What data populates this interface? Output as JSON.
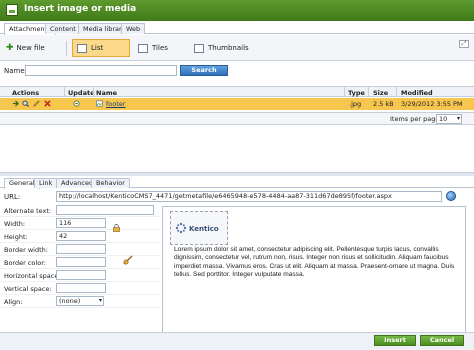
{
  "window": {
    "title": "Insert image or media"
  },
  "top_tabs": [
    "Attachments",
    "Content",
    "Media libraries",
    "Web"
  ],
  "toolbar": {
    "new_file": "New file",
    "list": "List",
    "tiles": "Tiles",
    "thumbnails": "Thumbnails"
  },
  "search": {
    "name_label": "Name:",
    "name_value": "",
    "button": "Search"
  },
  "grid": {
    "headers": {
      "actions": "Actions",
      "update": "Update",
      "name": "Name",
      "type": "Type",
      "size": "Size",
      "modified": "Modified"
    },
    "rows": [
      {
        "name": "footer",
        "type": ".jpg",
        "size": "2.5 kB",
        "modified": "3/29/2012 3:55 PM"
      }
    ]
  },
  "pager": {
    "label": "Items per page:",
    "value": "10"
  },
  "props_tabs": [
    "General",
    "Link",
    "Advanced",
    "Behavior"
  ],
  "url": {
    "label": "URL:",
    "value": "http://localhost/KenticoCMS7_4471/getmetafile/e6465948-e578-4484-aa87-311d67de895f/footer.aspx"
  },
  "props": {
    "alternate_text": {
      "label": "Alternate text:",
      "value": ""
    },
    "width": {
      "label": "Width:",
      "value": "116"
    },
    "height": {
      "label": "Height:",
      "value": "42"
    },
    "border_width": {
      "label": "Border width:",
      "value": ""
    },
    "border_color": {
      "label": "Border color:",
      "value": ""
    },
    "horizontal_space": {
      "label": "Horizontal space:",
      "value": ""
    },
    "vertical_space": {
      "label": "Vertical space:",
      "value": ""
    },
    "align": {
      "label": "Align:",
      "value": "(none)"
    }
  },
  "preview": {
    "logo_text": "Kentico",
    "text": "Lorem ipsum dolor sit amet, consectetur adipiscing elit. Pellentesque turpis lacus, convallis dignissim, consectetur vel, rutrum non, risus. Integer non risus et sollicitudin. Aliquam faucibus imperdiet massa. Vivamus eros. Cras ut elit. Aliquam at massa. Praesent-ornare ut magna. Duis tellus. Sed porttitor. Integer vulputate massa."
  },
  "buttons": {
    "insert": "Insert",
    "cancel": "Cancel"
  },
  "colors": {
    "title_bar": "#4d8724",
    "selected_row": "#f7c64e",
    "accent_button": "#2f72bb"
  }
}
